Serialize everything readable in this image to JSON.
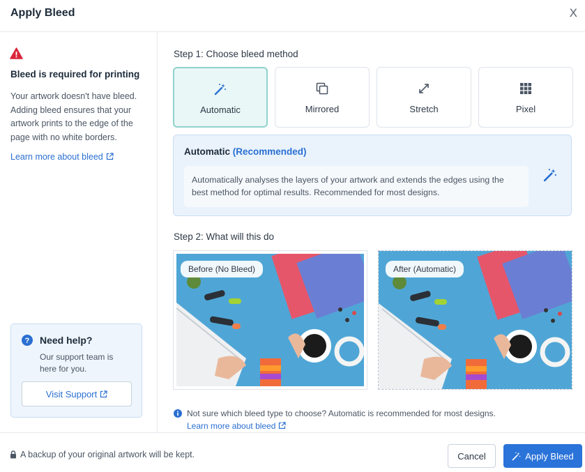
{
  "header": {
    "title": "Apply Bleed",
    "close_label": "X"
  },
  "sidebar": {
    "warning_icon": "warning-triangle-icon",
    "title": "Bleed is required for printing",
    "description": "Your artwork doesn't have bleed. Adding bleed ensures that your artwork prints to the edge of the page with no white borders.",
    "learn_more": "Learn more about bleed",
    "help": {
      "title": "Need help?",
      "text": "Our support team is here for you.",
      "button": "Visit Support"
    }
  },
  "main": {
    "step1_title": "Step 1: Choose bleed method",
    "methods": [
      {
        "label": "Automatic",
        "icon": "magic-wand-icon",
        "selected": true
      },
      {
        "label": "Mirrored",
        "icon": "copy-icon",
        "selected": false
      },
      {
        "label": "Stretch",
        "icon": "expand-arrows-icon",
        "selected": false
      },
      {
        "label": "Pixel",
        "icon": "grid-icon",
        "selected": false
      }
    ],
    "info": {
      "title": "Automatic",
      "badge": "(Recommended)",
      "description": "Automatically analyses the layers of your artwork and extends the edges using the best method for optimal results. Recommended for most designs."
    },
    "step2_title": "Step 2: What will this do",
    "preview_before": "Before (No Bleed)",
    "preview_after": "After (Automatic)",
    "note": "Not sure which bleed type to choose? Automatic is recommended for most designs.",
    "note_link": "Learn more about bleed"
  },
  "footer": {
    "backup_text": "A backup of your original artwork will be kept.",
    "cancel": "Cancel",
    "apply": "Apply Bleed"
  },
  "colors": {
    "accent": "#2a73d9",
    "selected_border": "#8fd3cc",
    "warning": "#d9263a"
  }
}
